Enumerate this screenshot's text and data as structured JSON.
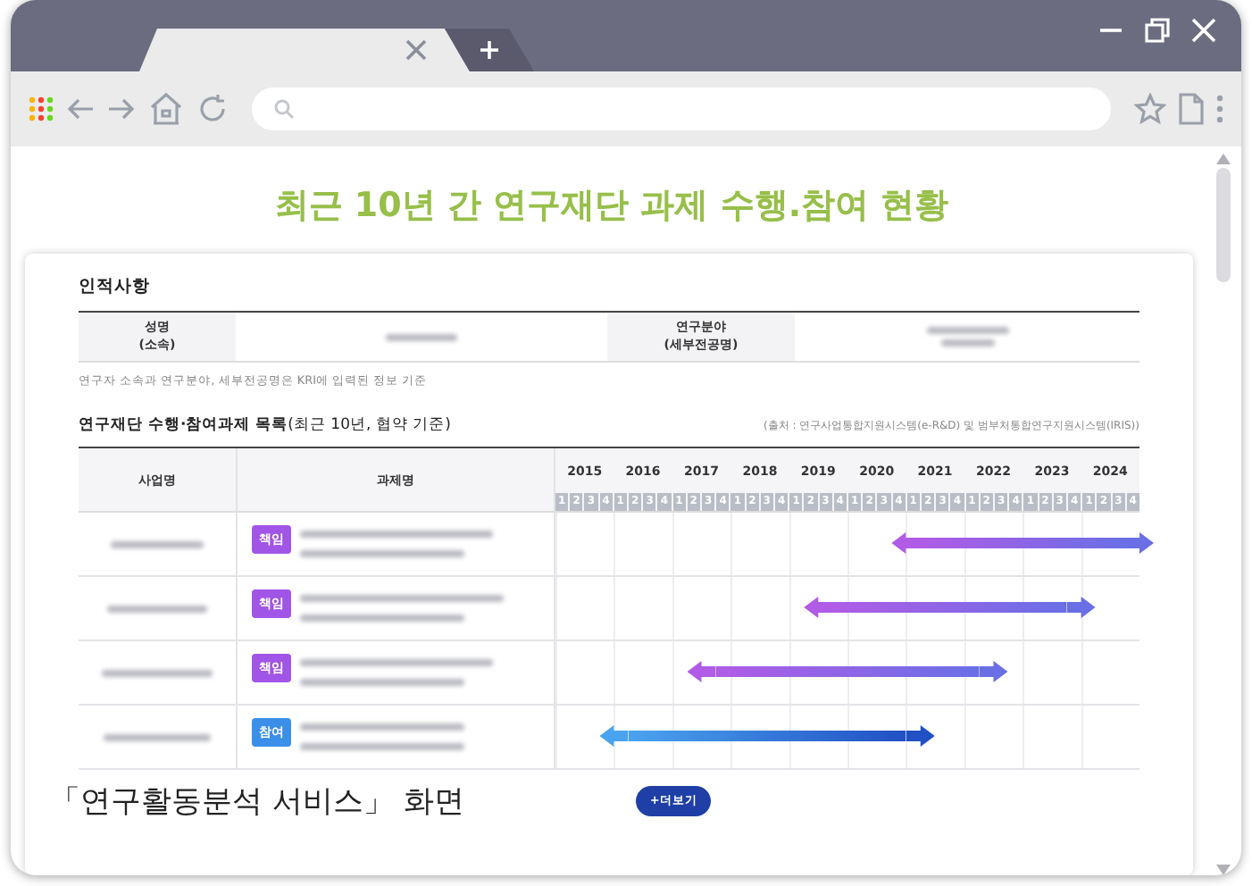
{
  "title": "최근 10년 간 연구재단 과제 수행.참여 현황",
  "profile": {
    "heading": "인적사항",
    "fields": [
      {
        "label": [
          "성명",
          "(소속)"
        ]
      },
      {
        "label": [
          "연구분야",
          "(세부전공명)"
        ]
      }
    ],
    "note": "연구자 소속과 연구분야, 세부전공명은 KRI에 입력된 정보 기준"
  },
  "projects": {
    "heading": "**연구재단 수행·참여과제 목록**(최근 10년, 협약 기준)",
    "source": "(출처 : 연구사업통합지원시스템(e-R&D) 및 범부처통합연구지원시스템(IRIS))",
    "columns": [
      "사업명",
      "과제명"
    ],
    "years": [
      {
        "year": "2015",
        "quarters": [
          "1",
          "2",
          "3",
          "4"
        ]
      },
      {
        "year": "2016",
        "quarters": [
          "1",
          "2",
          "3",
          "4"
        ]
      },
      {
        "year": "2017",
        "quarters": [
          "1",
          "2",
          "3",
          "4"
        ]
      },
      {
        "year": "2018",
        "quarters": [
          "1",
          "2",
          "3",
          "4"
        ]
      },
      {
        "year": "2019",
        "quarters": [
          "1",
          "2",
          "3",
          "4"
        ]
      },
      {
        "year": "2020",
        "quarters": [
          "1",
          "2",
          "3",
          "4"
        ]
      },
      {
        "year": "2021",
        "quarters": [
          "1",
          "2",
          "3",
          "4"
        ]
      },
      {
        "year": "2022",
        "quarters": [
          "1",
          "2",
          "3",
          "4"
        ]
      },
      {
        "year": "2023",
        "quarters": [
          "1",
          "2",
          "3",
          "4"
        ]
      },
      {
        "year": "2024",
        "quarters": [
          "1",
          "2",
          "3",
          "4"
        ]
      }
    ],
    "rows": [
      {
        "role": {
          "label": "책임",
          "kind": "lead"
        },
        "span": {
          "start": {
            "level": 0.6
          },
          "end": {
            "level": 1
          }
        }
      },
      {
        "role": {
          "label": "책임",
          "kind": "lead"
        },
        "span": {
          "start": {
            "level": 0.45
          },
          "end": {
            "level": 0.9
          }
        }
      },
      {
        "role": {
          "label": "책임",
          "kind": "lead"
        },
        "span": {
          "start": {
            "level": 0.25
          },
          "end": {
            "level": 0.75
          }
        }
      },
      {
        "role": {
          "label": "참여",
          "kind": "member"
        },
        "span": {
          "start": {
            "level": 0.1
          },
          "end": {
            "level": 0.625
          }
        }
      }
    ],
    "more_button": "+더보기"
  },
  "caption": "「연구활동분석 서비스」 화면"
}
